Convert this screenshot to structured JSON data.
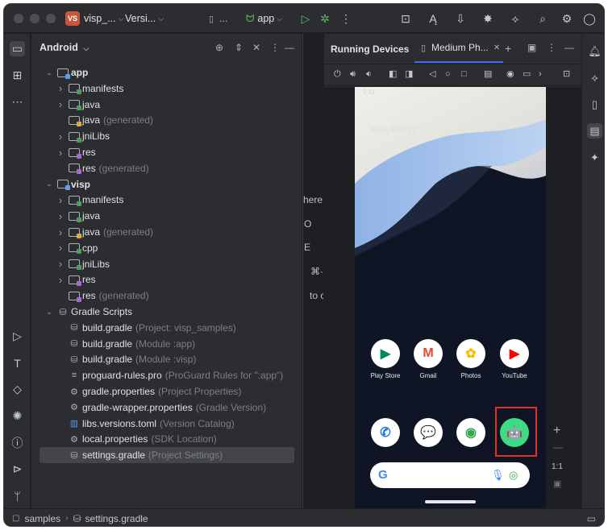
{
  "titlebar": {
    "project_badge": "VS",
    "project_name": "visp_...",
    "branch": "Versi...",
    "config": "...",
    "run_config": "app"
  },
  "project_panel": {
    "view_label": "Android",
    "tree": [
      {
        "label": "app",
        "hint": "",
        "kind": "module",
        "depth": 0,
        "expanded": true
      },
      {
        "label": "manifests",
        "hint": "",
        "kind": "folder",
        "depth": 1,
        "expanded": false
      },
      {
        "label": "java",
        "hint": "",
        "kind": "folder",
        "depth": 1,
        "expanded": false
      },
      {
        "label": "java",
        "hint": "(generated)",
        "kind": "gen",
        "depth": 1,
        "expanded": null
      },
      {
        "label": "jniLibs",
        "hint": "",
        "kind": "folder",
        "depth": 1,
        "expanded": false
      },
      {
        "label": "res",
        "hint": "",
        "kind": "res",
        "depth": 1,
        "expanded": false
      },
      {
        "label": "res",
        "hint": "(generated)",
        "kind": "res",
        "depth": 1,
        "expanded": null
      },
      {
        "label": "visp",
        "hint": "",
        "kind": "module",
        "depth": 0,
        "expanded": true
      },
      {
        "label": "manifests",
        "hint": "",
        "kind": "folder",
        "depth": 1,
        "expanded": false
      },
      {
        "label": "java",
        "hint": "",
        "kind": "folder",
        "depth": 1,
        "expanded": false
      },
      {
        "label": "java",
        "hint": "(generated)",
        "kind": "gen",
        "depth": 1,
        "expanded": false
      },
      {
        "label": "cpp",
        "hint": "",
        "kind": "folder",
        "depth": 1,
        "expanded": false
      },
      {
        "label": "jniLibs",
        "hint": "",
        "kind": "folder",
        "depth": 1,
        "expanded": false
      },
      {
        "label": "res",
        "hint": "",
        "kind": "res",
        "depth": 1,
        "expanded": false
      },
      {
        "label": "res",
        "hint": "(generated)",
        "kind": "res",
        "depth": 1,
        "expanded": null
      },
      {
        "label": "Gradle Scripts",
        "hint": "",
        "kind": "gradle",
        "depth": 0,
        "expanded": true
      },
      {
        "label": "build.gradle",
        "hint": "(Project: visp_samples)",
        "kind": "gradle-file",
        "depth": 1,
        "expanded": null
      },
      {
        "label": "build.gradle",
        "hint": "(Module :app)",
        "kind": "gradle-file",
        "depth": 1,
        "expanded": null
      },
      {
        "label": "build.gradle",
        "hint": "(Module :visp)",
        "kind": "gradle-file",
        "depth": 1,
        "expanded": null
      },
      {
        "label": "proguard-rules.pro",
        "hint": "(ProGuard Rules for \":app\")",
        "kind": "text-file",
        "depth": 1,
        "expanded": null
      },
      {
        "label": "gradle.properties",
        "hint": "(Project Properties)",
        "kind": "props-file",
        "depth": 1,
        "expanded": null
      },
      {
        "label": "gradle-wrapper.properties",
        "hint": "(Gradle Version)",
        "kind": "props-file",
        "depth": 1,
        "expanded": null
      },
      {
        "label": "libs.versions.toml",
        "hint": "(Version Catalog)",
        "kind": "toml-file",
        "depth": 1,
        "expanded": null
      },
      {
        "label": "local.properties",
        "hint": "(SDK Location)",
        "kind": "props-file",
        "depth": 1,
        "expanded": null
      },
      {
        "label": "settings.gradle",
        "hint": "(Project Settings)",
        "kind": "gradle-file",
        "depth": 1,
        "expanded": null,
        "selected": true
      }
    ]
  },
  "editor_fragments": [
    "here",
    "O",
    "E",
    "⌘·",
    "to c"
  ],
  "running_devices": {
    "title": "Running Devices",
    "tab_label": "Medium Ph...",
    "zoom_label": "1:1"
  },
  "phone": {
    "status_time": "9:41",
    "date": "Wed, Feb 19",
    "apps_row1": [
      {
        "label": "Play Store",
        "icon": "play-store-icon",
        "color": "#01875f",
        "glyph": "▶"
      },
      {
        "label": "Gmail",
        "icon": "gmail-icon",
        "color": "#ea4335",
        "glyph": "M"
      },
      {
        "label": "Photos",
        "icon": "photos-icon",
        "color": "#fbbc04",
        "glyph": "✿"
      },
      {
        "label": "YouTube",
        "icon": "youtube-icon",
        "color": "#ff0000",
        "glyph": "▶"
      }
    ],
    "dock": [
      {
        "label": "",
        "icon": "phone-icon",
        "color": "#1a73e8",
        "glyph": "✆"
      },
      {
        "label": "",
        "icon": "messages-icon",
        "color": "#1a73e8",
        "glyph": "💬"
      },
      {
        "label": "",
        "icon": "chrome-icon",
        "color": "#34a853",
        "glyph": "◉"
      },
      {
        "label": "",
        "icon": "android-app-icon",
        "color": "#3ddc84",
        "glyph": "🤖"
      }
    ],
    "search_logo": "G"
  },
  "statusbar": {
    "breadcrumb_root": "samples",
    "breadcrumb_file": "settings.gradle"
  }
}
